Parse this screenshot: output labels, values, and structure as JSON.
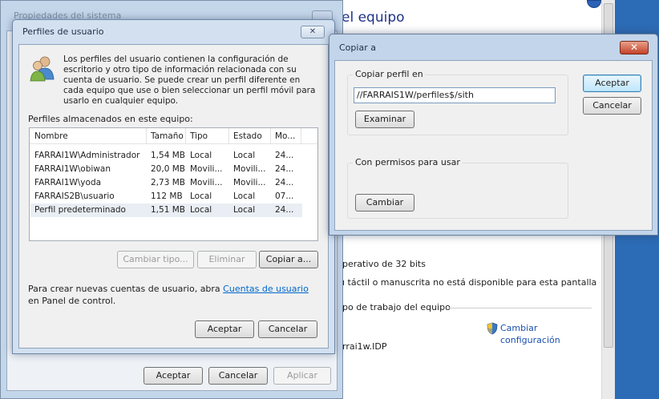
{
  "background_window": {
    "heading": "el equipo",
    "lines": [
      "perativo de 32 bits",
      "ı táctil o manuscrita no está disponible para esta pantalla",
      "po de trabajo del equipo",
      "rrai1w.IDP"
    ],
    "change_settings_line1": "Cambiar",
    "change_settings_line2": "configuración"
  },
  "system_properties": {
    "title": "Propiedades del sistema",
    "accept_label": "Aceptar",
    "cancel_label": "Cancelar",
    "apply_label": "Aplicar"
  },
  "user_profiles": {
    "title": "Perfiles de usuario",
    "description": "Los perfiles del usuario contienen la configuración de escritorio y otro tipo de información relacionada con su cuenta de usuario. Se puede crear un perfil diferente en cada equipo que use o bien seleccionar un perfil móvil para usarlo en cualquier equipo.",
    "stored_label": "Perfiles almacenados en este equipo:",
    "columns": [
      "Nombre",
      "Tamaño",
      "Tipo",
      "Estado",
      "Mo..."
    ],
    "rows": [
      [
        "FARRAI1W\\Administrador",
        "1,54 MB",
        "Local",
        "Local",
        "24..."
      ],
      [
        "FARRAI1W\\obiwan",
        "20,0 MB",
        "Movili...",
        "Movili...",
        "24..."
      ],
      [
        "FARRAI1W\\yoda",
        "2,73 MB",
        "Movili...",
        "Movili...",
        "24..."
      ],
      [
        "FARRAIS2B\\usuario",
        "112 MB",
        "Local",
        "Local",
        "07..."
      ],
      [
        "Perfil predeterminado",
        "1,51 MB",
        "Local",
        "Local",
        "24..."
      ]
    ],
    "change_type_label": "Cambiar tipo...",
    "delete_label": "Eliminar",
    "copy_to_label": "Copiar a...",
    "note_prefix": "Para crear nuevas cuentas de usuario, abra ",
    "note_link": "Cuentas de usuario",
    "note_suffix": " en Panel de control.",
    "accept_label": "Aceptar",
    "cancel_label": "Cancelar"
  },
  "copy_to": {
    "title": "Copiar a",
    "copy_profile_group": "Copiar perfil en",
    "path_value": "//FARRAIS1W/perfiles$/sith",
    "browse_label": "Examinar",
    "permissions_group": "Con permisos para usar",
    "change_label": "Cambiar",
    "accept_label": "Aceptar",
    "cancel_label": "Cancelar"
  }
}
